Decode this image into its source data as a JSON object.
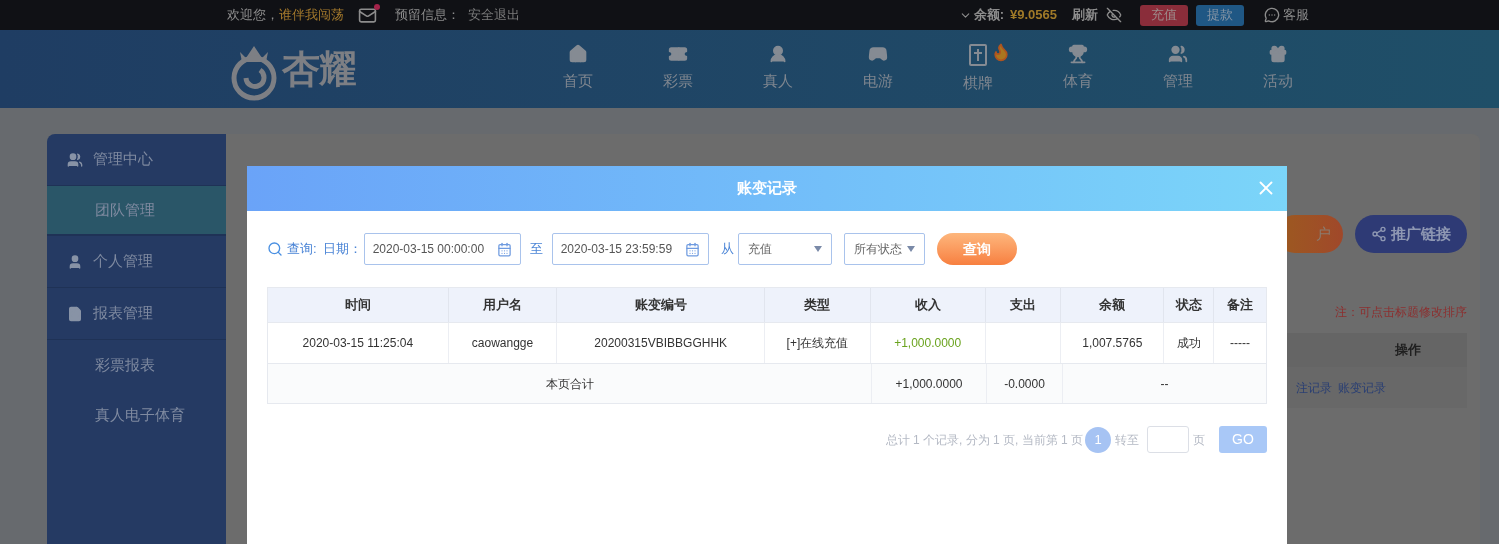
{
  "top_bar": {
    "welcome": "欢迎您，",
    "username": "谁伴我闯荡",
    "mail_unread": true,
    "reserved_label": "预留信息：",
    "logout": "安全退出",
    "balance_label": "余额:",
    "balance": "¥9.0565",
    "refresh": "刷新",
    "deposit": "充值",
    "withdraw": "提款",
    "service": "客服"
  },
  "nav": {
    "logo": "杏耀",
    "items": [
      {
        "label": "首页",
        "hot": false
      },
      {
        "label": "彩票",
        "hot": false
      },
      {
        "label": "真人",
        "hot": false
      },
      {
        "label": "电游",
        "hot": false
      },
      {
        "label": "棋牌",
        "hot": true
      },
      {
        "label": "体育",
        "hot": false
      },
      {
        "label": "管理",
        "hot": false
      },
      {
        "label": "活动",
        "hot": false
      }
    ]
  },
  "sidebar": {
    "items": [
      {
        "label": "管理中心",
        "children": [
          {
            "label": "团队管理",
            "selected": true
          }
        ]
      },
      {
        "label": "个人管理"
      },
      {
        "label": "报表管理",
        "children": [
          {
            "label": "彩票报表",
            "selected": false
          },
          {
            "label": "真人电子体育",
            "selected": false
          }
        ]
      }
    ]
  },
  "page": {
    "open_account_visible": "户",
    "promo_link": "推广链接",
    "note": "注：可点击标题修改排序",
    "table_header": "操作",
    "row_links": [
      "注记录",
      "账变记录"
    ]
  },
  "modal": {
    "title": "账变记录",
    "query": {
      "label": "查询:",
      "date_label": "日期：",
      "start": "2020-03-15 00:00:00",
      "to": "至",
      "end": "2020-03-15 23:59:59",
      "from": "从",
      "type": "充值",
      "status": "所有状态",
      "button": "查询"
    },
    "columns": [
      "时间",
      "用户名",
      "账变编号",
      "类型",
      "收入",
      "支出",
      "余额",
      "状态",
      "备注"
    ],
    "rows": [
      {
        "time": "2020-03-15 11:25:04",
        "username": "caowangge",
        "txn_id": "20200315VBIBBGGHHK",
        "type": "[+]在线充值",
        "income": "+1,000.0000",
        "balance": "1,007.5765",
        "status": "成功",
        "remark": "-----"
      }
    ],
    "total": {
      "label": "本页合计",
      "income": "+1,000.0000",
      "expense": "-0.0000",
      "rest": "--"
    },
    "pagination": {
      "summary": "总计 1 个记录, 分为 1 页, 当前第 1 页",
      "current": "1",
      "goto": "转至",
      "unit": "页",
      "go": "GO"
    }
  }
}
